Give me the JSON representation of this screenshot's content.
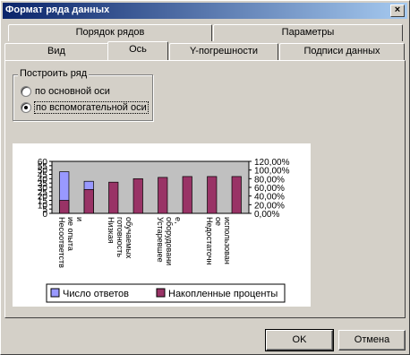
{
  "dialog": {
    "title": "Формат ряда данных",
    "close_glyph": "×"
  },
  "tabs_row_back": [
    {
      "label": "Порядок рядов"
    },
    {
      "label": "Параметры"
    }
  ],
  "tabs_row_front": [
    {
      "label": "Вид"
    },
    {
      "label": "Ось",
      "active": true
    },
    {
      "label": "Y-погрешности"
    },
    {
      "label": "Подписи данных"
    }
  ],
  "axis_group": {
    "legend": "Построить ряд",
    "options": [
      {
        "label": "по основной оси",
        "checked": false
      },
      {
        "label": "по вспомогательной оси",
        "checked": true
      }
    ]
  },
  "buttons": {
    "ok": "OK",
    "cancel": "Отмена"
  },
  "chart_data": {
    "type": "bar",
    "categories": [
      "Несоответствие опыта",
      "",
      "Низкая готовность обучаемых",
      "",
      "Устаревшее оборудование",
      "",
      "Недостаточное использование",
      ""
    ],
    "category_labels_display": [
      [
        "Несоответств",
        "ие опыта",
        "и"
      ],
      [
        "Низкая",
        "готовность",
        "обучаемых"
      ],
      [
        "Устаревшее",
        "оборудовани",
        "е,"
      ],
      [
        "Недостаточн",
        "ое",
        "использован"
      ]
    ],
    "series": [
      {
        "name": "Число ответов",
        "axis": "primary",
        "color": "#9999ff",
        "values": [
          48,
          37,
          0,
          0,
          0,
          0,
          0,
          0
        ]
      },
      {
        "name": "Накопленные проценты",
        "axis": "secondary",
        "color": "#993366",
        "values": [
          0.3,
          0.55,
          0.72,
          0.8,
          0.83,
          0.85,
          0.85,
          0.85
        ]
      }
    ],
    "ylim": [
      0,
      60
    ],
    "y_ticks": [
      "0",
      "5",
      "10",
      "15",
      "20",
      "25",
      "30",
      "35",
      "40",
      "45",
      "50",
      "55",
      "60"
    ],
    "y2lim": [
      0,
      1.2
    ],
    "y2_ticks": [
      "0,00%",
      "20,00%",
      "40,00%",
      "60,00%",
      "80,00%",
      "100,00%",
      "120,00%"
    ],
    "legend_position": "bottom",
    "plot_background": "#c0c0c0"
  }
}
